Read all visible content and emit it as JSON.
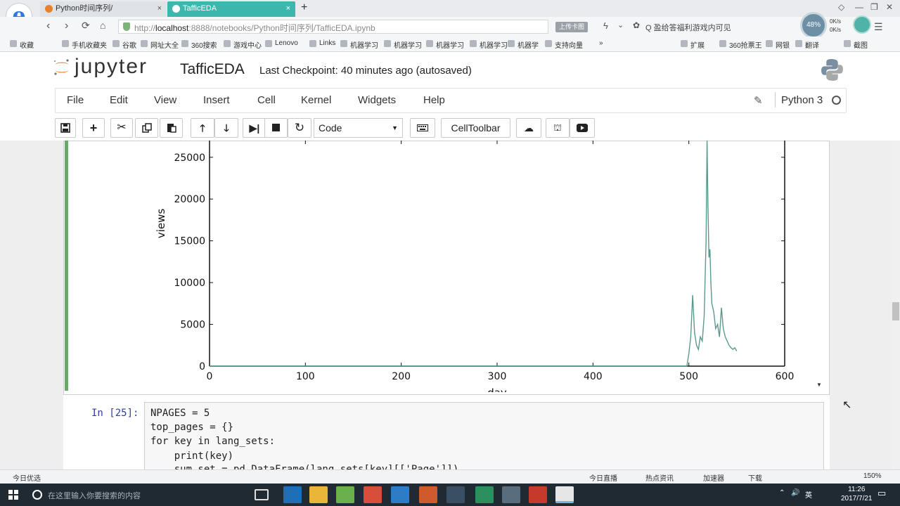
{
  "browser": {
    "tabs": [
      {
        "label": "Python时间序列/",
        "close": "×"
      },
      {
        "label": "TafficEDA",
        "close": "×"
      }
    ],
    "new_tab": "+",
    "window_controls": [
      "◇",
      "—",
      "❐",
      "✕"
    ],
    "nav_icons": [
      "back-icon",
      "forward-icon",
      "reload-icon",
      "home-icon"
    ],
    "address": {
      "prefix": "http://",
      "host": "localhost",
      "rest": ":8888/notebooks/Python时间序列/TafficEDA.ipynb"
    },
    "address_pill": "上传卡图",
    "search_hint": "Q 盈给答福利游戏内可见",
    "speed_orb": "48%",
    "netspeed_up": "0K/s",
    "netspeed_down": "0K/s",
    "bookmarks": [
      "收藏",
      "手机收藏夹",
      "谷歌",
      "网址大全",
      "360搜索",
      "游戏中心",
      "Lenovo",
      "Links",
      "机器学习",
      "机器学习",
      "机器学习",
      "机器学习",
      "机器学",
      "支持向量",
      "»"
    ],
    "bookmarks_right": [
      "扩展",
      "360抢票王",
      "网银",
      "翻译",
      "截图"
    ],
    "status_left": "今日优选",
    "status_right": [
      "今日直播",
      "热点资讯",
      "加速器",
      "下载",
      "150%"
    ]
  },
  "jupyter": {
    "logo_text": "jupyter",
    "notebook_name": "TafficEDA",
    "checkpoint": "Last Checkpoint: 40 minutes ago (autosaved)",
    "menu": [
      "File",
      "Edit",
      "View",
      "Insert",
      "Cell",
      "Kernel",
      "Widgets",
      "Help"
    ],
    "kernel": "Python 3",
    "toolbar_icons": [
      "save-icon",
      "add-cell-icon",
      "cut-icon",
      "copy-icon",
      "paste-icon",
      "move-up-icon",
      "move-down-icon",
      "run-icon",
      "stop-icon",
      "restart-icon"
    ],
    "cell_type": "Code",
    "cell_toolbar": "CellToolbar",
    "extra_icons": [
      "keyboard-icon",
      "upload-icon",
      "gift-icon",
      "youtube-icon"
    ]
  },
  "code_cell": {
    "prompt": "In [25]:",
    "lines": [
      "NPAGES = 5",
      "top_pages = {}",
      "for key in lang_sets:",
      "    print(key)",
      "    sum_set = pd.DataFrame(lang_sets[key][['Page']])"
    ]
  },
  "chart_data": {
    "type": "line",
    "title": "",
    "xlabel": "day",
    "ylabel": "views",
    "xlim": [
      0,
      600
    ],
    "ylim": [
      0,
      27000
    ],
    "xticks": [
      0,
      100,
      200,
      300,
      400,
      500,
      600
    ],
    "yticks": [
      0,
      5000,
      10000,
      15000,
      20000,
      25000
    ],
    "color": "#5a9a8e",
    "series": [
      {
        "x": [
          0,
          450,
          498,
          500,
          502,
          504,
          506,
          508,
          510,
          512,
          514,
          516,
          518,
          519,
          520,
          521,
          522,
          523,
          524,
          526,
          528,
          530,
          532,
          534,
          536,
          538,
          540,
          542,
          544,
          546,
          548,
          550
        ],
        "y": [
          0,
          0,
          0,
          1500,
          3500,
          8500,
          4000,
          2500,
          2000,
          3500,
          3000,
          6000,
          15000,
          27000,
          19000,
          13000,
          14000,
          10000,
          7500,
          6500,
          4500,
          5000,
          3500,
          7000,
          4500,
          3500,
          3000,
          2500,
          2200,
          2000,
          2200,
          1800
        ]
      }
    ]
  },
  "taskbar": {
    "search_placeholder": "在这里输入你要搜索的内容",
    "tray": [
      "英",
      "⌃",
      "🔊"
    ],
    "time": "11:26",
    "date": "2017/7/21"
  }
}
